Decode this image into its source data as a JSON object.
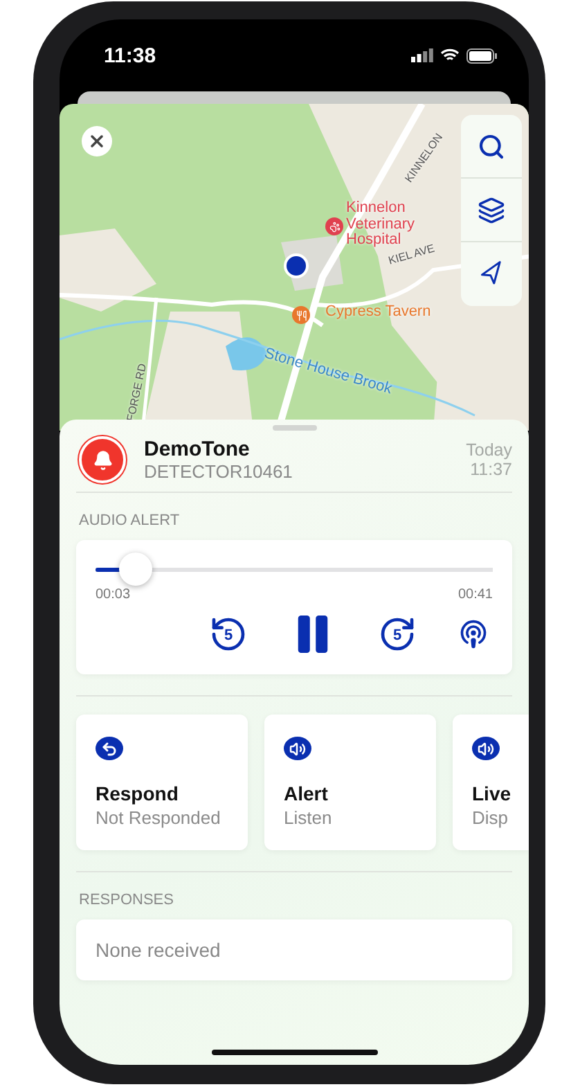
{
  "status_bar": {
    "time": "11:38"
  },
  "map": {
    "labels": [
      {
        "kind": "road",
        "text": "KINNELON"
      },
      {
        "kind": "poi",
        "text": "Kinnelon Veterinary Hospital"
      },
      {
        "kind": "road",
        "text": "KIEL AVE"
      },
      {
        "kind": "food",
        "text": "Cypress Tavern"
      },
      {
        "kind": "road",
        "text": "FORGE RD"
      },
      {
        "kind": "water",
        "text": "Stone House Brook"
      }
    ]
  },
  "alert": {
    "title": "DemoTone",
    "subtitle": "DETECTOR10461",
    "date": "Today",
    "time": "11:37"
  },
  "audio": {
    "section": "AUDIO ALERT",
    "level": 0.1,
    "elapsed": "00:03",
    "total": "00:41",
    "playing": true,
    "rewind": "5",
    "forward": "5"
  },
  "actions": [
    {
      "title": "Respond",
      "subtitle": "Not Responded"
    },
    {
      "title": "Alert",
      "subtitle": "Listen"
    },
    {
      "title": "Live",
      "subtitle": "Disp"
    }
  ],
  "responses": {
    "section": "RESPONSES",
    "empty": "None received"
  }
}
